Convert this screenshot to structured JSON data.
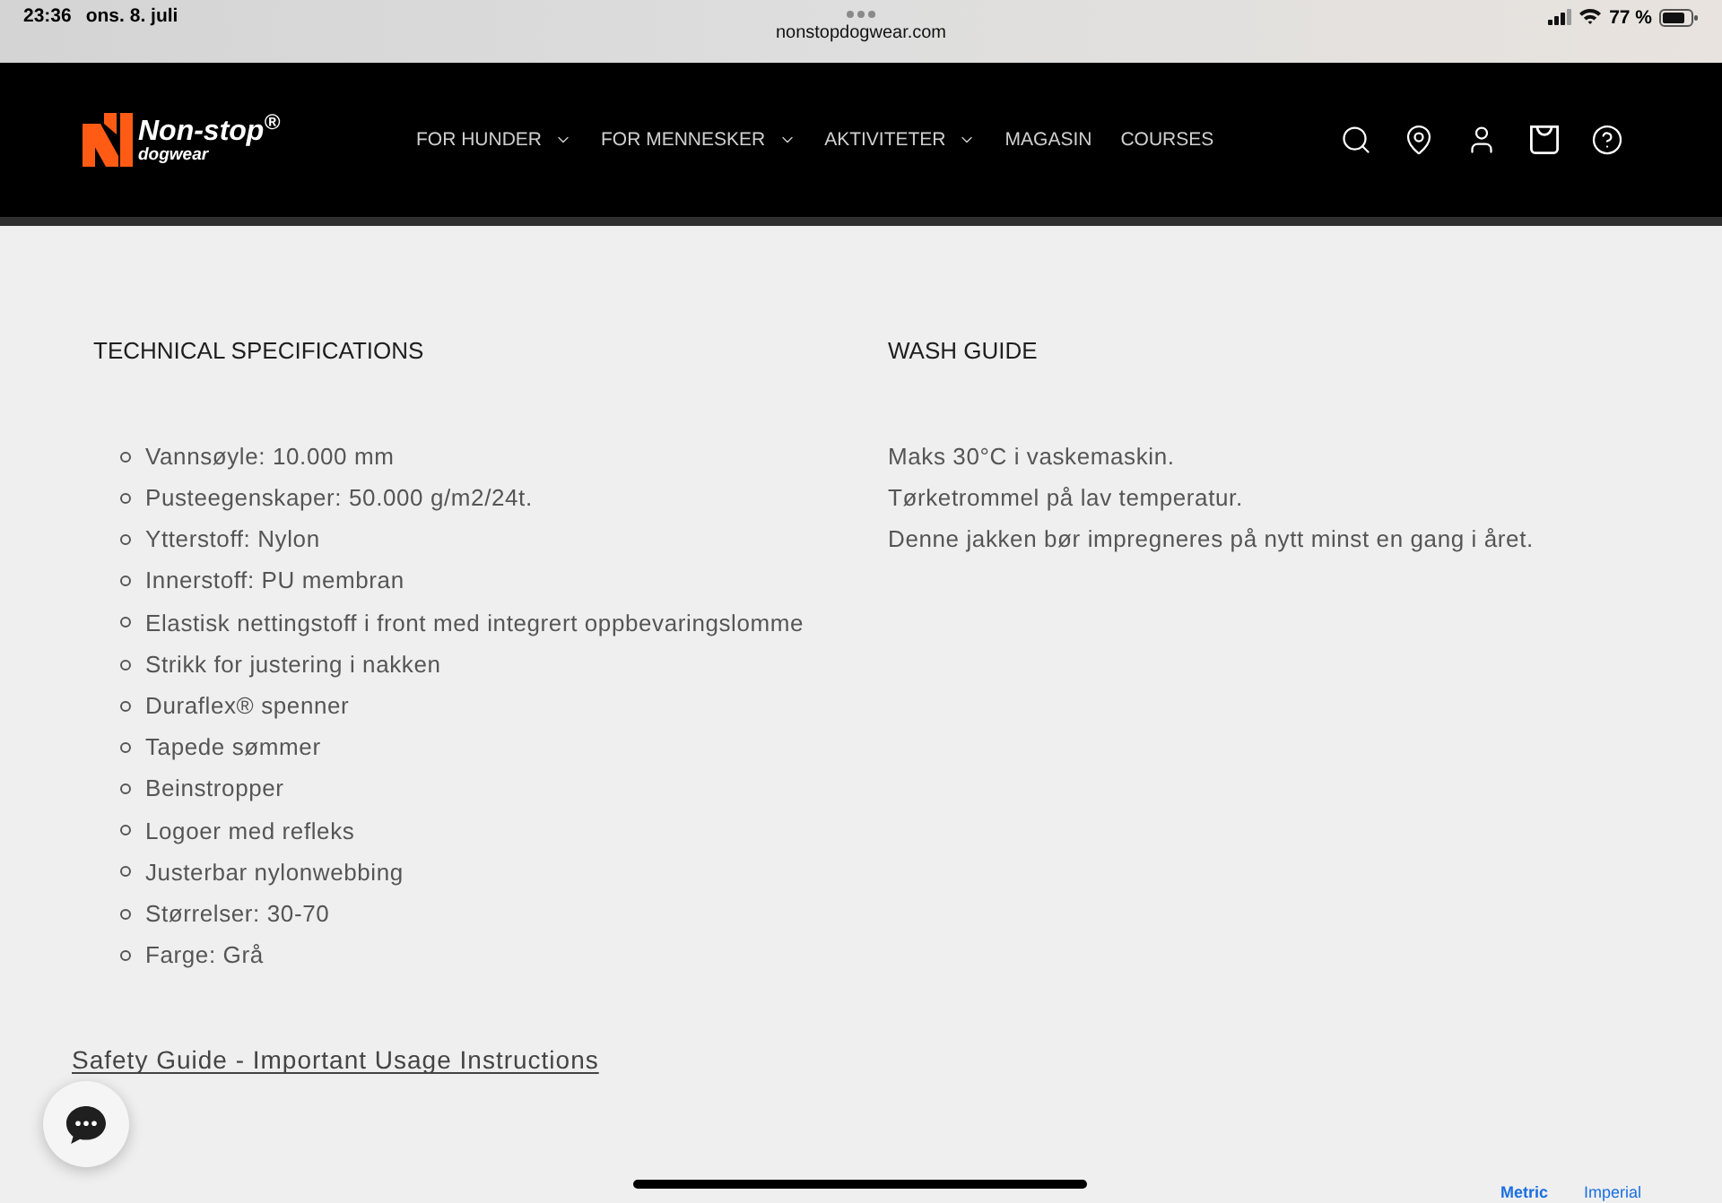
{
  "status_bar": {
    "time": "23:36",
    "date": "ons. 8. juli",
    "url": "nonstopdogwear.com",
    "battery": "77 %"
  },
  "header": {
    "brand": {
      "name": "Non-stop$^{®}$",
      "tagline": "dogwear"
    },
    "nav": [
      {
        "label": "FOR HUNDER",
        "dropdown": true
      },
      {
        "label": "FOR MENNESKER",
        "dropdown": true
      },
      {
        "label": "AKTIVITETER",
        "dropdown": true
      },
      {
        "label": "MAGASIN",
        "dropdown": false
      },
      {
        "label": "COURSES",
        "dropdown": false
      }
    ]
  },
  "sections": [
    {
      "title": "TECHNICAL SPECIFICATIONS",
      "kind": "bullets",
      "items": [
        "Vannsøyle: 10.000 mm",
        "Pusteegenskaper: 50.000 g/m2/24t.",
        "Ytterstoff: Nylon",
        "Innerstoff: PU membran",
        "Elastisk nettingstoff i front med integrert oppbevaringslomme",
        "Strikk for justering i nakken",
        "Duraflex® spenner",
        "Tapede sømmer",
        "Beinstropper",
        "Logoer med refleks",
        "Justerbar nylonwebbing",
        "Størrelser: 30-70",
        "Farge: Grå"
      ]
    },
    {
      "title": "WASH GUIDE",
      "kind": "lines",
      "items": [
        "Maks 30°C i vaskemaskin.",
        "Tørketrommel på lav temperatur.",
        "Denne jakken bør impregneres på nytt minst en gang i året."
      ]
    }
  ],
  "safety_link": "Safety Guide - Important Usage Instructions",
  "units": [
    {
      "label": "Metric",
      "selected": true
    },
    {
      "label": "Imperial",
      "selected": false
    }
  ]
}
